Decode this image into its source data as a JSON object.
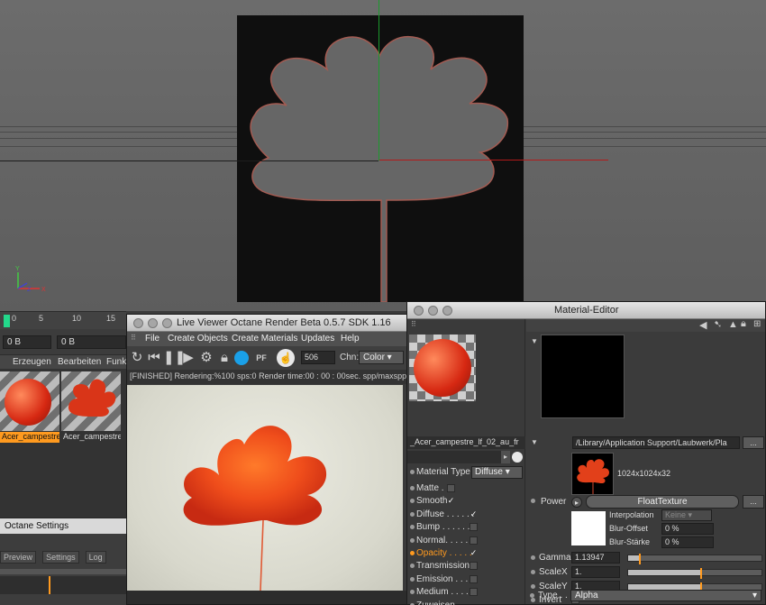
{
  "timeline": {
    "ticks": [
      "0",
      "5",
      "10",
      "15"
    ]
  },
  "frame_fields": [
    "0 B",
    "0 B"
  ],
  "material_manager": {
    "menu": [
      "Erzeugen",
      "Bearbeiten",
      "Funkt"
    ],
    "materials": [
      {
        "name": "Acer_campestre",
        "selected": true
      },
      {
        "name": "Acer_campestre",
        "selected": false
      }
    ]
  },
  "octane_settings": {
    "title": "Octane Settings",
    "tabs": [
      "Preview",
      "Settings",
      "Log"
    ]
  },
  "live_viewer": {
    "title": "Live Viewer     Octane Render Beta 0.5.7     SDK 1.16",
    "menu": [
      "File",
      "Create Objects",
      "Create Materials",
      "Updates",
      "Help"
    ],
    "spp_value": "506",
    "channel_label": "Chn:",
    "channel_value": "Color",
    "status": "[FINISHED]   Rendering:%100 sps:0 Render time:00 : 00 : 00sec. spp/maxspp",
    "icons": [
      "reload-icon",
      "first-frame-icon",
      "pause-icon",
      "play-icon",
      "gear-icon",
      "lock-icon",
      "sphere-icon",
      "pf-icon",
      "pointer-icon"
    ]
  },
  "material_editor": {
    "title": "Material-Editor",
    "material_name": "_Acer_campestre_lf_02_au_fr",
    "material_type_label": "Material Type",
    "material_type_value": "Diffuse",
    "channels": [
      {
        "label": "Matte . .",
        "checked": false,
        "active": false
      },
      {
        "label": "Smooth",
        "checked": true,
        "active": false
      },
      {
        "label": "Diffuse . . . . . .",
        "checked": true,
        "active": false
      },
      {
        "label": "Bump . . . . . . .",
        "checked": false,
        "active": false
      },
      {
        "label": "Normal. . . . . .",
        "checked": false,
        "active": false
      },
      {
        "label": "Opacity . . . . .",
        "checked": true,
        "active": true
      },
      {
        "label": "Transmission",
        "checked": false,
        "active": false
      },
      {
        "label": "Emission . . . .",
        "checked": false,
        "active": false
      },
      {
        "label": "Medium . . . . .",
        "checked": false,
        "active": false
      },
      {
        "label": "Zuweisen",
        "checked": null,
        "active": false
      }
    ],
    "texture_path": "/Library/Application Support/Laubwerk/Pla",
    "path_button": "...",
    "resolution": "1024x1024x32",
    "power_label": "Power",
    "float_texture": "FloatTexture",
    "power_button": "...",
    "interpolation_label": "Interpolation",
    "interpolation_value": "Keine",
    "blur_offset_label": "Blur-Offset",
    "blur_offset_value": "0 %",
    "blur_strength_label": "Blur-Stärke",
    "blur_strength_value": "0 %",
    "gamma_label": "Gamma",
    "gamma_value": "1.13947",
    "gamma_level": 0.09,
    "scalex_label": "ScaleX",
    "scalex_value": "1.",
    "scalex_level": 0.55,
    "scaley_label": "ScaleY",
    "scaley_value": "1.",
    "scaley_level": 0.55,
    "invert_label": "Invert",
    "type_label": "Type . .",
    "type_value": "Alpha"
  },
  "colors": {
    "accent": "#ff9a1f",
    "leaf_red": "#e2401a",
    "timeline_green": "#23d88b"
  }
}
